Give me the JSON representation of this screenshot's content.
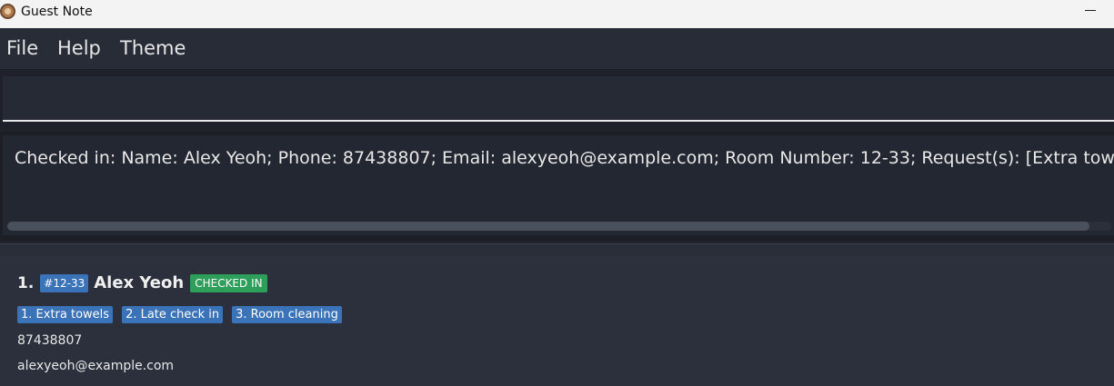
{
  "window": {
    "title": "Guest Note",
    "minimize_symbol": "—"
  },
  "menu": {
    "items": [
      "File",
      "Help",
      "Theme"
    ]
  },
  "command": {
    "value": ""
  },
  "result": {
    "text": "Checked in: Name: Alex Yeoh; Phone: 87438807; Email: alexyeoh@example.com; Room Number: 12-33; Request(s): [Extra towels][Late check in][Room cleaning]"
  },
  "guests": [
    {
      "index": "1.",
      "room": "#12-33",
      "name": "Alex Yeoh",
      "status": "CHECKED IN",
      "requests": [
        "1. Extra towels",
        "2. Late check in",
        "3. Room cleaning"
      ],
      "phone": "87438807",
      "email": "alexyeoh@example.com"
    }
  ],
  "colors": {
    "tag_blue": "#3a73b8",
    "status_green": "#2e9e5b",
    "background": "#1f222a"
  }
}
